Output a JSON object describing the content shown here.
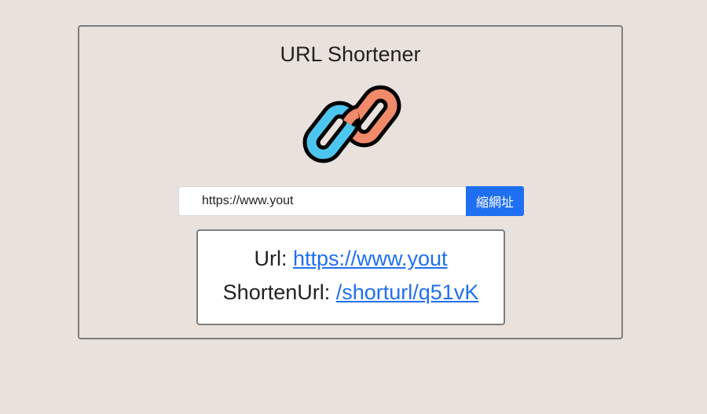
{
  "app": {
    "title": "URL Shortener",
    "logo_icon": "chain-link-icon"
  },
  "form": {
    "url_input_value": "https://www.yout",
    "shorten_button_label": "縮網址"
  },
  "result": {
    "url_label": "Url:",
    "url_value": "https://www.yout",
    "short_label": "ShortenUrl:",
    "short_value": "/shorturl/q51vK"
  },
  "colors": {
    "background": "#e9e1dc",
    "accent": "#1f6ff2",
    "chain_blue": "#4dc6ef",
    "chain_orange": "#f08a6b"
  }
}
